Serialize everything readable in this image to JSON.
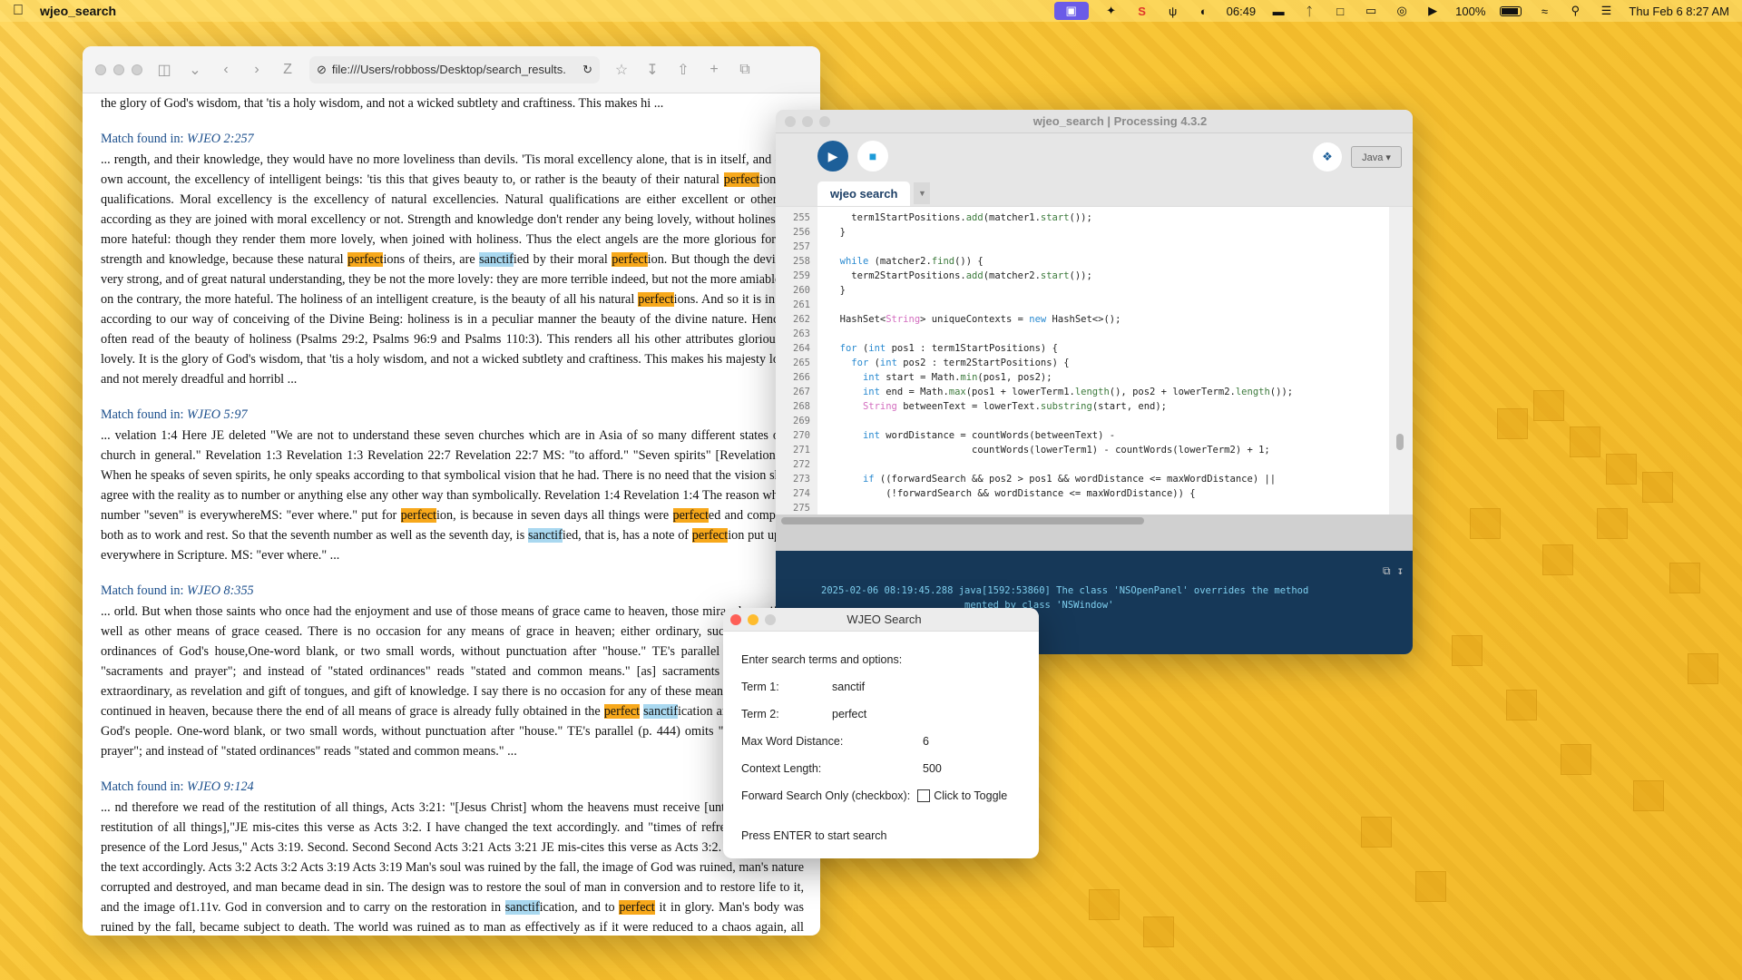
{
  "menubar": {
    "app_name": "wjeo_search",
    "time_short": "06:49",
    "battery": "100%",
    "datetime": "Thu Feb 6  8:27 AM"
  },
  "browser": {
    "url": "file:///Users/robboss/Desktop/search_results.",
    "top_fragment": "the glory of God's wisdom, that 'tis a holy wisdom, and not a wicked subtlety and craftiness. This makes hi ...",
    "matches": [
      {
        "label": "Match found in: ",
        "ref": "WJEO 2:257",
        "segments": [
          {
            "t": "... rength, and their knowledge, they would have no more loveliness than devils. 'Tis moral excellency alone, that is in itself, and on its own account, the excellency of intelligent beings: 'tis this that gives beauty to, or rather is the beauty of their natural "
          },
          {
            "t": "perfect",
            "h": "p"
          },
          {
            "t": "ions and qualifications. Moral excellency is the excellency of natural excellencies. Natural qualifications are either excellent or otherwise, according as they are joined with moral excellency or not. Strength and knowledge don't render any being lovely, without holiness, but more hateful: though they render them more lovely, when joined with holiness. Thus the elect angels are the more glorious for their strength and knowledge, because these natural "
          },
          {
            "t": "perfect",
            "h": "p"
          },
          {
            "t": "ions of theirs, are "
          },
          {
            "t": "sanctif",
            "h": "s"
          },
          {
            "t": "ied by their moral "
          },
          {
            "t": "perfect",
            "h": "p"
          },
          {
            "t": "ion. But though the devils are very strong, and of great natural understanding, they be not the more lovely: they are more terrible indeed, but not the more amiable; but on the contrary, the more hateful. The holiness of an intelligent creature, is the beauty of all his natural "
          },
          {
            "t": "perfect",
            "h": "p"
          },
          {
            "t": "ions. And so it is in God, according to our way of conceiving of the Divine Being: holiness is in a peculiar manner the beauty of the divine nature. Hence we often read of the beauty of holiness (Psalms 29:2, Psalms 96:9 and Psalms 110:3). This renders all his other attributes glorious and lovely. It is the glory of God's wisdom, that 'tis a holy wisdom, and not a wicked subtlety and craftiness. This makes his majesty lovely, and not merely dreadful and horribl ..."
          }
        ]
      },
      {
        "label": "Match found in: ",
        "ref": "WJEO 5:97",
        "segments": [
          {
            "t": "... velation 1:4 Here JE deleted \"We are not to understand these seven churches which are in Asia of so many different states of the church in general.\" Revelation 1:3 Revelation 1:3 Revelation 22:7 Revelation 22:7 MS: \"to afford.\" \"Seven spirits\" [Revelation 1:4]. When he speaks of seven spirits, he only speaks according to that symbolical vision that he had. There is no need that the vision should agree with the reality as to number or anything else any other way than symbolically. Revelation 1:4 Revelation 1:4 The reason why the number \"seven\" is everywhereMS: \"ever where.\" put for "
          },
          {
            "t": "perfect",
            "h": "p"
          },
          {
            "t": "ion, is because in seven days all things were "
          },
          {
            "t": "perfect",
            "h": "p"
          },
          {
            "t": "ed and completed, both as to work and rest. So that the seventh number as well as the seventh day, is "
          },
          {
            "t": "sanctif",
            "h": "s"
          },
          {
            "t": "ied, that is, has a note of "
          },
          {
            "t": "perfect",
            "h": "p"
          },
          {
            "t": "ion put upon it everywhere in Scripture. MS: \"ever where.\" ..."
          }
        ]
      },
      {
        "label": "Match found in: ",
        "ref": "WJEO 8:355",
        "segments": [
          {
            "t": "... orld. But when those saints who once had the enjoyment and use of those means of grace came to heaven, those miraculous gifts, as well as other means of grace ceased. There is no occasion for any means of grace in heaven; either ordinary, such as the stated ordinances of God's house,One-word blank, or two small words, without punctuation after \"house.\" TE's parallel (p. 444) omits \"sacraments and prayer\"; and instead of \"stated ordinances\" reads \"stated and common means.\" [as] sacraments and prayer, or extraordinary, as revelation and gift of tongues, and gift of knowledge. I say there is no occasion for any of these means of grace to be continued in heaven, because there the end of all means of grace is already fully obtained in the "
          },
          {
            "t": "perfect",
            "h": "p"
          },
          {
            "t": " "
          },
          {
            "t": "sanctif",
            "h": "s"
          },
          {
            "t": "ication and happiness of God's people. One-word blank, or two small words, without punctuation after \"house.\" TE's parallel (p. 444) omits \"sacraments and prayer\"; and instead of \"stated ordinances\" reads \"stated and common means.\" ..."
          }
        ]
      },
      {
        "label": "Match found in: ",
        "ref": "WJEO 9:124",
        "segments": [
          {
            "t": "... nd therefore we read of the restitution of all things, Acts 3:21: \"[Jesus Christ] whom the heavens must receive [until the times of] restitution of all things],\"JE mis-cites this verse as Acts 3:2. I have changed the text accordingly. and \"times of refreshing from the presence of the Lord Jesus,\" Acts 3:19. Second. Second Second Acts 3:21 Acts 3:21 JE mis-cites this verse as Acts 3:2. I have changed the text accordingly. Acts 3:2 Acts 3:2 Acts 3:19 Acts 3:19 Man's soul was ruined by the fall, the image of God was ruined, man's nature corrupted and destroyed, and man became dead in sin. The design was to restore the soul of man in conversion and to restore life to it, and the image of1.11v. God in conversion and to carry on the restoration in "
          },
          {
            "t": "sanctif",
            "h": "s"
          },
          {
            "t": "ication, and to "
          },
          {
            "t": "perfect",
            "h": "p"
          },
          {
            "t": " it in glory. Man's body was ruined by the fall, became subject to death. The world was ruined as to man as effectively as if it were reduced to a chaos again, all heaven and earth were overthrown. But the design was to restore all ..."
          }
        ]
      }
    ]
  },
  "processing": {
    "title": "wjeo_search | Processing 4.3.2",
    "mode": "Java ▾",
    "tab": "wjeo search",
    "line_numbers": [
      "255",
      "256",
      "257",
      "258",
      "259",
      "260",
      "261",
      "262",
      "263",
      "264",
      "265",
      "266",
      "267",
      "268",
      "269",
      "270",
      "271",
      "272",
      "273",
      "274",
      "275"
    ],
    "console_lines": [
      "2025-02-06 08:19:45.288 java[1592:53860] The class 'NSOpenPanel' overrides the method",
      "                         mented by class 'NSWindow'"
    ]
  },
  "dialog": {
    "title": "WJEO Search",
    "heading": "Enter search terms and options:",
    "term1_label": "Term 1:",
    "term1_value": "sanctif",
    "term2_label": "Term 2:",
    "term2_value": "perfect",
    "maxdist_label": "Max Word Distance:",
    "maxdist_value": "6",
    "context_label": "Context Length:",
    "context_value": "500",
    "forward_label": "Forward Search Only (checkbox):",
    "toggle_label": "Click to Toggle",
    "footer": "Press ENTER to start search"
  }
}
